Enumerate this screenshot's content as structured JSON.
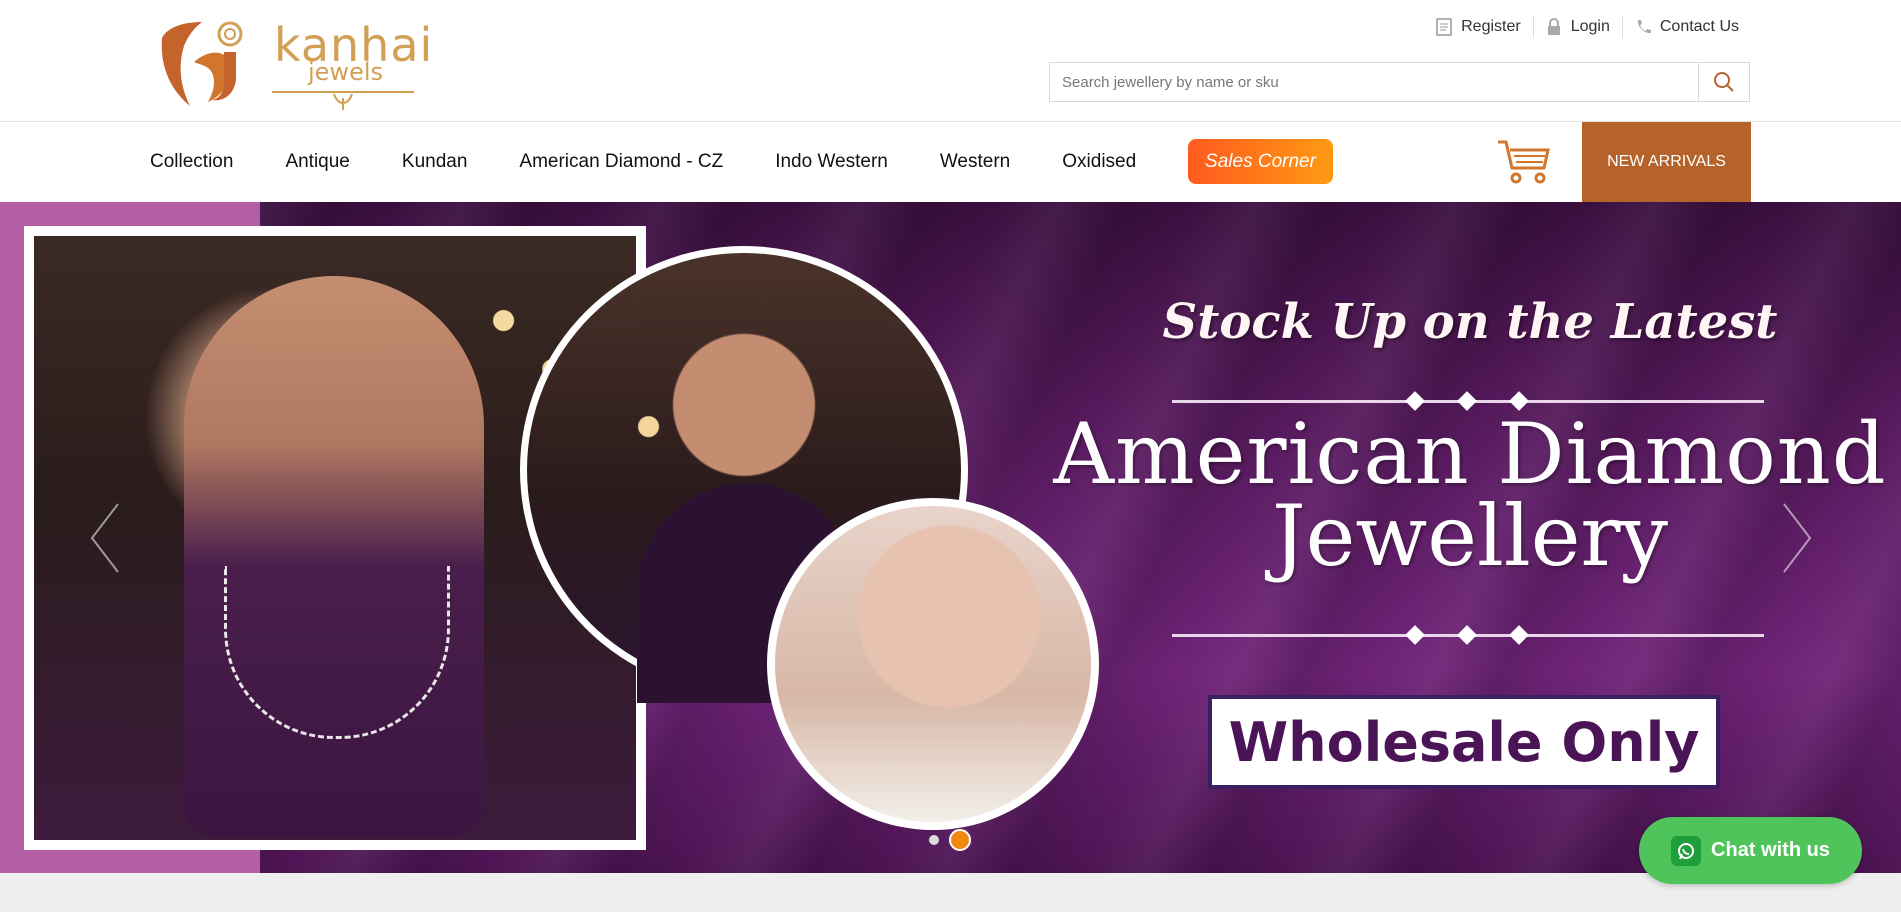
{
  "brand": {
    "name": "kanhai",
    "sub": "jewels"
  },
  "top_links": {
    "register": "Register",
    "login": "Login",
    "contact": "Contact Us"
  },
  "search": {
    "placeholder": "Search jewellery by name or sku",
    "value": ""
  },
  "nav": {
    "items": [
      "Collection",
      "Antique",
      "Kundan",
      "American Diamond - CZ",
      "Indo Western",
      "Western",
      "Oxidised"
    ],
    "sales_corner": "Sales Corner",
    "new_arrivals": "NEW ARRIVALS"
  },
  "hero": {
    "line1": "Stock Up on the Latest",
    "line2": "American Diamond",
    "line3": "Jewellery",
    "badge": "Wholesale Only",
    "slides": 2,
    "active_slide": 2
  },
  "chat": {
    "label": "Chat with us"
  },
  "colors": {
    "accent": "#b5632b",
    "sales": "#ff6a1a",
    "chat": "#4fc45a",
    "hero_purple": "#5c1c63"
  },
  "icons": [
    "register-icon",
    "lock-icon",
    "phone-icon",
    "search-icon",
    "cart-icon",
    "chevron-left-icon",
    "chevron-right-icon",
    "whatsapp-icon"
  ]
}
